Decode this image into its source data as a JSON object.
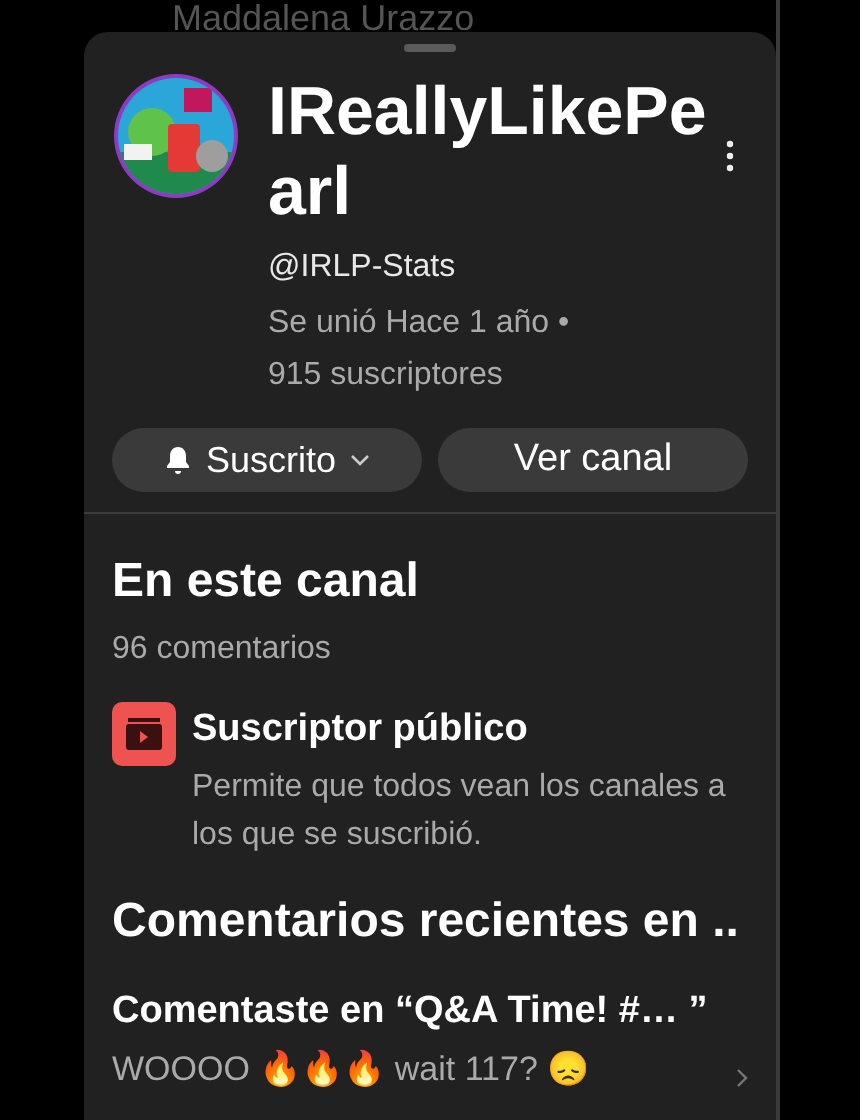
{
  "background_text": "Maddalena Urazzo",
  "channel": {
    "name": "IReallyLikePearl",
    "handle": "@IRLP-Stats",
    "joined": "Se unió Hace 1 año •",
    "subscribers": "915 suscriptores"
  },
  "buttons": [
    {
      "kind": "subscribe",
      "label": "Suscrito"
    },
    {
      "kind": "plain",
      "label": "Ver canal"
    }
  ],
  "section": {
    "title": "En este canal",
    "count": "96 comentarios"
  },
  "feature": {
    "title": "Suscriptor público",
    "description": "Permite que todos vean los canales a los que se suscribió."
  },
  "recent": {
    "title": "Comentarios recientes en ..",
    "comments": [
      {
        "title": "Comentaste en “Q&A Time! #… ”",
        "text": "WOOOO 🔥🔥🔥 wait 117? 😞"
      }
    ]
  }
}
